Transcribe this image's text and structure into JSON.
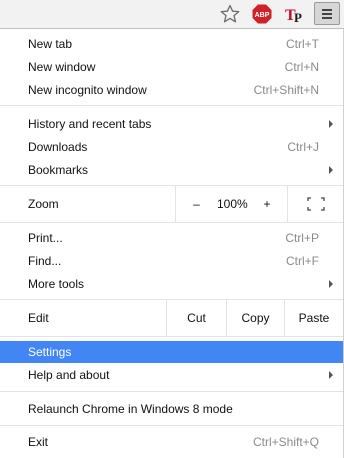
{
  "toolbar": {
    "bookmark_icon": "star-outline-icon",
    "adblock": {
      "label": "ABP",
      "color": "#d12027"
    },
    "extension_tp": {
      "label": "TP",
      "color_t": "#c8102e",
      "color_p": "#1a1a1a"
    },
    "menu_icon": "hamburger-menu-icon"
  },
  "menu": {
    "new_tab": {
      "label": "New tab",
      "shortcut": "Ctrl+T"
    },
    "new_window": {
      "label": "New window",
      "shortcut": "Ctrl+N"
    },
    "new_incognito": {
      "label": "New incognito window",
      "shortcut": "Ctrl+Shift+N"
    },
    "history": {
      "label": "History and recent tabs"
    },
    "downloads": {
      "label": "Downloads",
      "shortcut": "Ctrl+J"
    },
    "bookmarks": {
      "label": "Bookmarks"
    },
    "zoom": {
      "label": "Zoom",
      "minus": "–",
      "value": "100%",
      "plus": "+"
    },
    "print": {
      "label": "Print...",
      "shortcut": "Ctrl+P"
    },
    "find": {
      "label": "Find...",
      "shortcut": "Ctrl+F"
    },
    "more_tools": {
      "label": "More tools"
    },
    "edit": {
      "label": "Edit",
      "cut": "Cut",
      "copy": "Copy",
      "paste": "Paste"
    },
    "settings": {
      "label": "Settings",
      "selected": true
    },
    "help": {
      "label": "Help and about"
    },
    "relaunch": {
      "label": "Relaunch Chrome in Windows 8 mode"
    },
    "exit": {
      "label": "Exit",
      "shortcut": "Ctrl+Shift+Q"
    }
  },
  "colors": {
    "highlight": "#4285f4",
    "shortcut_text": "#8a8a8a",
    "separator": "#e3e3e3"
  }
}
